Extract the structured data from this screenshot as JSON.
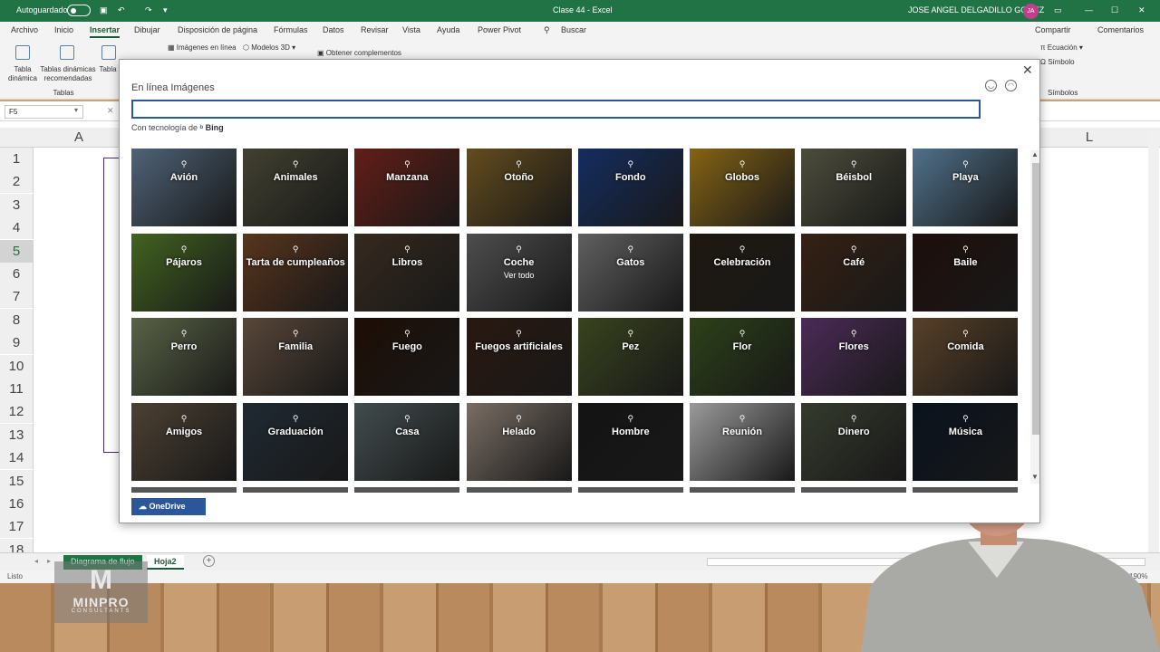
{
  "titlebar": {
    "autosave_label": "Autoguardado",
    "title": "Clase 44 - Excel",
    "user": "JOSE ANGEL DELGADILLO GOMEZ",
    "avatar_initials": "JA"
  },
  "ribbon_tabs": [
    "Archivo",
    "Inicio",
    "Insertar",
    "Dibujar",
    "Disposición de página",
    "Fórmulas",
    "Datos",
    "Revisar",
    "Vista",
    "Ayuda",
    "Power Pivot"
  ],
  "active_tab": "Insertar",
  "search_label": "Buscar",
  "share_label": "Compartir",
  "comments_label": "Comentarios",
  "ribbon": {
    "pivot_label": "Tabla dinámica",
    "pivot_label2": "dinámica",
    "recommended_label": "Tablas dinámicas",
    "recommended_label2": "recomendadas",
    "table_label": "Tabla",
    "group_tables": "Tablas",
    "online_images": "Imágenes en línea",
    "models3d": "Modelos 3D",
    "get_addins": "Obtener complementos",
    "equation": "Ecuación",
    "symbol": "Símbolo",
    "group_symbols": "Símbolos"
  },
  "formula_bar": {
    "name_box": "F5"
  },
  "grid": {
    "col_a": "A",
    "col_l": "L",
    "rows": [
      "1",
      "2",
      "3",
      "4",
      "5",
      "6",
      "7",
      "8",
      "9",
      "10",
      "11",
      "12",
      "13",
      "14",
      "15",
      "16",
      "17",
      "18"
    ]
  },
  "sheets": {
    "sheet1": "Diagrama de flujo",
    "sheet2": "Hoja2"
  },
  "status": {
    "ready": "Listo",
    "zoom": "190%"
  },
  "logo": {
    "brand": "MINPRO",
    "sub": "CONSULTANTS"
  },
  "dialog": {
    "title": "En línea Imágenes",
    "search_value": "",
    "powered_by": "Con tecnología de",
    "bing": "Bing",
    "onedrive": "OneDrive",
    "see_all": "Ver todo",
    "tiles": [
      {
        "label": "Avión",
        "color": "#6f8aa6"
      },
      {
        "label": "Animales",
        "color": "#5c5a44"
      },
      {
        "label": "Manzana",
        "color": "#8a2a20"
      },
      {
        "label": "Otoño",
        "color": "#8a6a2a"
      },
      {
        "label": "Fondo",
        "color": "#1d3f86"
      },
      {
        "label": "Globos",
        "color": "#b88a1c"
      },
      {
        "label": "Béisbol",
        "color": "#6b6b55"
      },
      {
        "label": "Playa",
        "color": "#6f9dc0"
      },
      {
        "label": "Pájaros",
        "color": "#5c8a2c"
      },
      {
        "label": "Tarta de cumpleaños",
        "color": "#7a4a28"
      },
      {
        "label": "Libros",
        "color": "#4a3a2c"
      },
      {
        "label": "Coche",
        "color": "#6c6c6c"
      },
      {
        "label": "Gatos",
        "color": "#858585"
      },
      {
        "label": "Celebración",
        "color": "#2c2218"
      },
      {
        "label": "Café",
        "color": "#4a2e1c"
      },
      {
        "label": "Baile",
        "color": "#2a1410"
      },
      {
        "label": "Perro",
        "color": "#7c8a62"
      },
      {
        "label": "Familia",
        "color": "#7a6250"
      },
      {
        "label": "Fuego",
        "color": "#2a1408"
      },
      {
        "label": "Fuegos artificiales",
        "color": "#3a2218"
      },
      {
        "label": "Pez",
        "color": "#4f5e2a"
      },
      {
        "label": "Flor",
        "color": "#3e5a22"
      },
      {
        "label": "Flores",
        "color": "#6a3c7a"
      },
      {
        "label": "Comida",
        "color": "#7a5a38"
      },
      {
        "label": "Amigos",
        "color": "#6a5a48"
      },
      {
        "label": "Graduación",
        "color": "#2c3a48"
      },
      {
        "label": "Casa",
        "color": "#5c6a6c"
      },
      {
        "label": "Helado",
        "color": "#a8988c"
      },
      {
        "label": "Hombre",
        "color": "#1c1c1c"
      },
      {
        "label": "Reunión",
        "color": "#d6d6d6"
      },
      {
        "label": "Dinero",
        "color": "#4a5240"
      },
      {
        "label": "Música",
        "color": "#0e1a2a"
      }
    ]
  }
}
